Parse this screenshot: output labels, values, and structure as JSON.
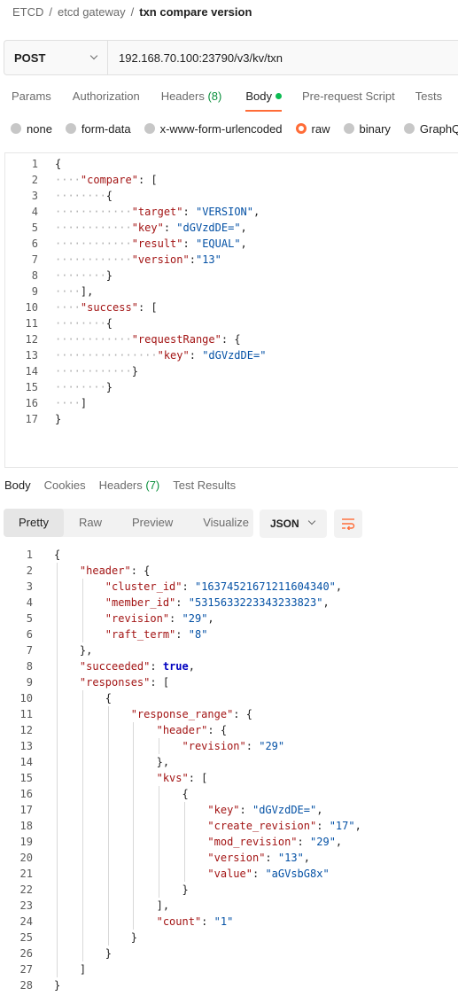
{
  "breadcrumb": {
    "collection": "ETCD",
    "folder": "etcd gateway",
    "request": "txn compare version",
    "separator": "/"
  },
  "request": {
    "method": "POST",
    "url": "192.168.70.100:23790/v3/kv/txn"
  },
  "request_tabs": [
    {
      "label": "Params",
      "count": ""
    },
    {
      "label": "Authorization",
      "count": ""
    },
    {
      "label": "Headers",
      "count": "(8)"
    },
    {
      "label": "Body",
      "count": "",
      "active": true
    },
    {
      "label": "Pre-request Script",
      "count": ""
    },
    {
      "label": "Tests",
      "count": ""
    }
  ],
  "body_types": [
    {
      "label": "none",
      "checked": false
    },
    {
      "label": "form-data",
      "checked": false
    },
    {
      "label": "x-www-form-urlencoded",
      "checked": false
    },
    {
      "label": "raw",
      "checked": true
    },
    {
      "label": "binary",
      "checked": false
    },
    {
      "label": "GraphQL",
      "checked": false
    }
  ],
  "request_body_lines": [
    "{",
    "    \"compare\": [",
    "        {",
    "            \"target\": \"VERSION\",",
    "            \"key\": \"dGVzdDE=\",",
    "            \"result\": \"EQUAL\",",
    "            \"version\":\"13\"",
    "        }",
    "    ],",
    "    \"success\": [",
    "        {",
    "            \"requestRange\": {",
    "                \"key\": \"dGVzdDE=\"",
    "            }",
    "        }",
    "    ]",
    "}"
  ],
  "response_tabs": [
    {
      "label": "Body",
      "count": "",
      "active": true
    },
    {
      "label": "Cookies",
      "count": ""
    },
    {
      "label": "Headers",
      "count": "(7)"
    },
    {
      "label": "Test Results",
      "count": ""
    }
  ],
  "view_modes": [
    {
      "label": "Pretty",
      "active": true
    },
    {
      "label": "Raw",
      "active": false
    },
    {
      "label": "Preview",
      "active": false
    },
    {
      "label": "Visualize",
      "active": false
    }
  ],
  "format_select": "JSON",
  "response_body_lines": [
    "{",
    "    \"header\": {",
    "        \"cluster_id\": \"16374521671211604340\",",
    "        \"member_id\": \"5315633223343233823\",",
    "        \"revision\": \"29\",",
    "        \"raft_term\": \"8\"",
    "    },",
    "    \"succeeded\": true,",
    "    \"responses\": [",
    "        {",
    "            \"response_range\": {",
    "                \"header\": {",
    "                    \"revision\": \"29\"",
    "                },",
    "                \"kvs\": [",
    "                    {",
    "                        \"key\": \"dGVzdDE=\",",
    "                        \"create_revision\": \"17\",",
    "                        \"mod_revision\": \"29\",",
    "                        \"version\": \"13\",",
    "                        \"value\": \"aGVsbG8x\"",
    "                    }",
    "                ],",
    "                \"count\": \"1\"",
    "            }",
    "        }",
    "    ]",
    "}"
  ],
  "colors": {
    "accent": "#ff6c37",
    "json_key": "#a31515",
    "json_string": "#0451a5",
    "json_bool": "#0000c0",
    "count_green": "#0a8f3c"
  },
  "icons": {
    "method_dropdown": "chevron-down-icon",
    "format_dropdown": "chevron-down-icon",
    "wrap": "wrap-lines-icon"
  }
}
